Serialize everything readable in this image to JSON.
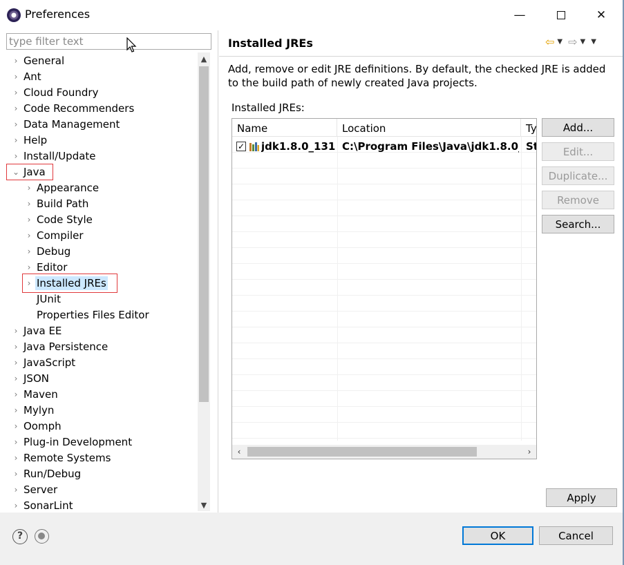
{
  "window": {
    "title": "Preferences",
    "minimize_glyph": "—",
    "close_glyph": "✕"
  },
  "left": {
    "filter_placeholder": "type filter text",
    "tree": [
      {
        "label": "General",
        "indent": 0,
        "arrow": "›"
      },
      {
        "label": "Ant",
        "indent": 0,
        "arrow": "›"
      },
      {
        "label": "Cloud Foundry",
        "indent": 0,
        "arrow": "›"
      },
      {
        "label": "Code Recommenders",
        "indent": 0,
        "arrow": "›"
      },
      {
        "label": "Data Management",
        "indent": 0,
        "arrow": "›"
      },
      {
        "label": "Help",
        "indent": 0,
        "arrow": "›"
      },
      {
        "label": "Install/Update",
        "indent": 0,
        "arrow": "›"
      },
      {
        "label": "Java",
        "indent": 0,
        "arrow": "⌄"
      },
      {
        "label": "Appearance",
        "indent": 1,
        "arrow": "›"
      },
      {
        "label": "Build Path",
        "indent": 1,
        "arrow": "›"
      },
      {
        "label": "Code Style",
        "indent": 1,
        "arrow": "›"
      },
      {
        "label": "Compiler",
        "indent": 1,
        "arrow": "›"
      },
      {
        "label": "Debug",
        "indent": 1,
        "arrow": "›"
      },
      {
        "label": "Editor",
        "indent": 1,
        "arrow": "›"
      },
      {
        "label": "Installed JREs",
        "indent": 1,
        "arrow": "›",
        "selected": true
      },
      {
        "label": "JUnit",
        "indent": 1,
        "arrow": ""
      },
      {
        "label": "Properties Files Editor",
        "indent": 1,
        "arrow": ""
      },
      {
        "label": "Java EE",
        "indent": 0,
        "arrow": "›"
      },
      {
        "label": "Java Persistence",
        "indent": 0,
        "arrow": "›"
      },
      {
        "label": "JavaScript",
        "indent": 0,
        "arrow": "›"
      },
      {
        "label": "JSON",
        "indent": 0,
        "arrow": "›"
      },
      {
        "label": "Maven",
        "indent": 0,
        "arrow": "›"
      },
      {
        "label": "Mylyn",
        "indent": 0,
        "arrow": "›"
      },
      {
        "label": "Oomph",
        "indent": 0,
        "arrow": "›"
      },
      {
        "label": "Plug-in Development",
        "indent": 0,
        "arrow": "›"
      },
      {
        "label": "Remote Systems",
        "indent": 0,
        "arrow": "›"
      },
      {
        "label": "Run/Debug",
        "indent": 0,
        "arrow": "›"
      },
      {
        "label": "Server",
        "indent": 0,
        "arrow": "›"
      },
      {
        "label": "SonarLint",
        "indent": 0,
        "arrow": "›"
      }
    ]
  },
  "right": {
    "title": "Installed JREs",
    "description": "Add, remove or edit JRE definitions. By default, the checked JRE is added to the build path of newly created Java projects.",
    "table_label": "Installed JREs:",
    "columns": [
      "Name",
      "Location",
      "Ty"
    ],
    "rows": [
      {
        "checked": true,
        "check_glyph": "✓",
        "name": "jdk1.8.0_131...",
        "location": "C:\\Program Files\\Java\\jdk1.8.0_...",
        "type": "St"
      }
    ],
    "buttons": {
      "add": "Add...",
      "edit": "Edit...",
      "duplicate": "Duplicate...",
      "remove": "Remove",
      "search": "Search..."
    },
    "apply": "Apply"
  },
  "footer": {
    "help_glyph": "?",
    "ok": "OK",
    "cancel": "Cancel"
  },
  "colors": {
    "selection": "#cce8ff",
    "highlight": "#e0383b",
    "default_button_border": "#0078d7"
  }
}
